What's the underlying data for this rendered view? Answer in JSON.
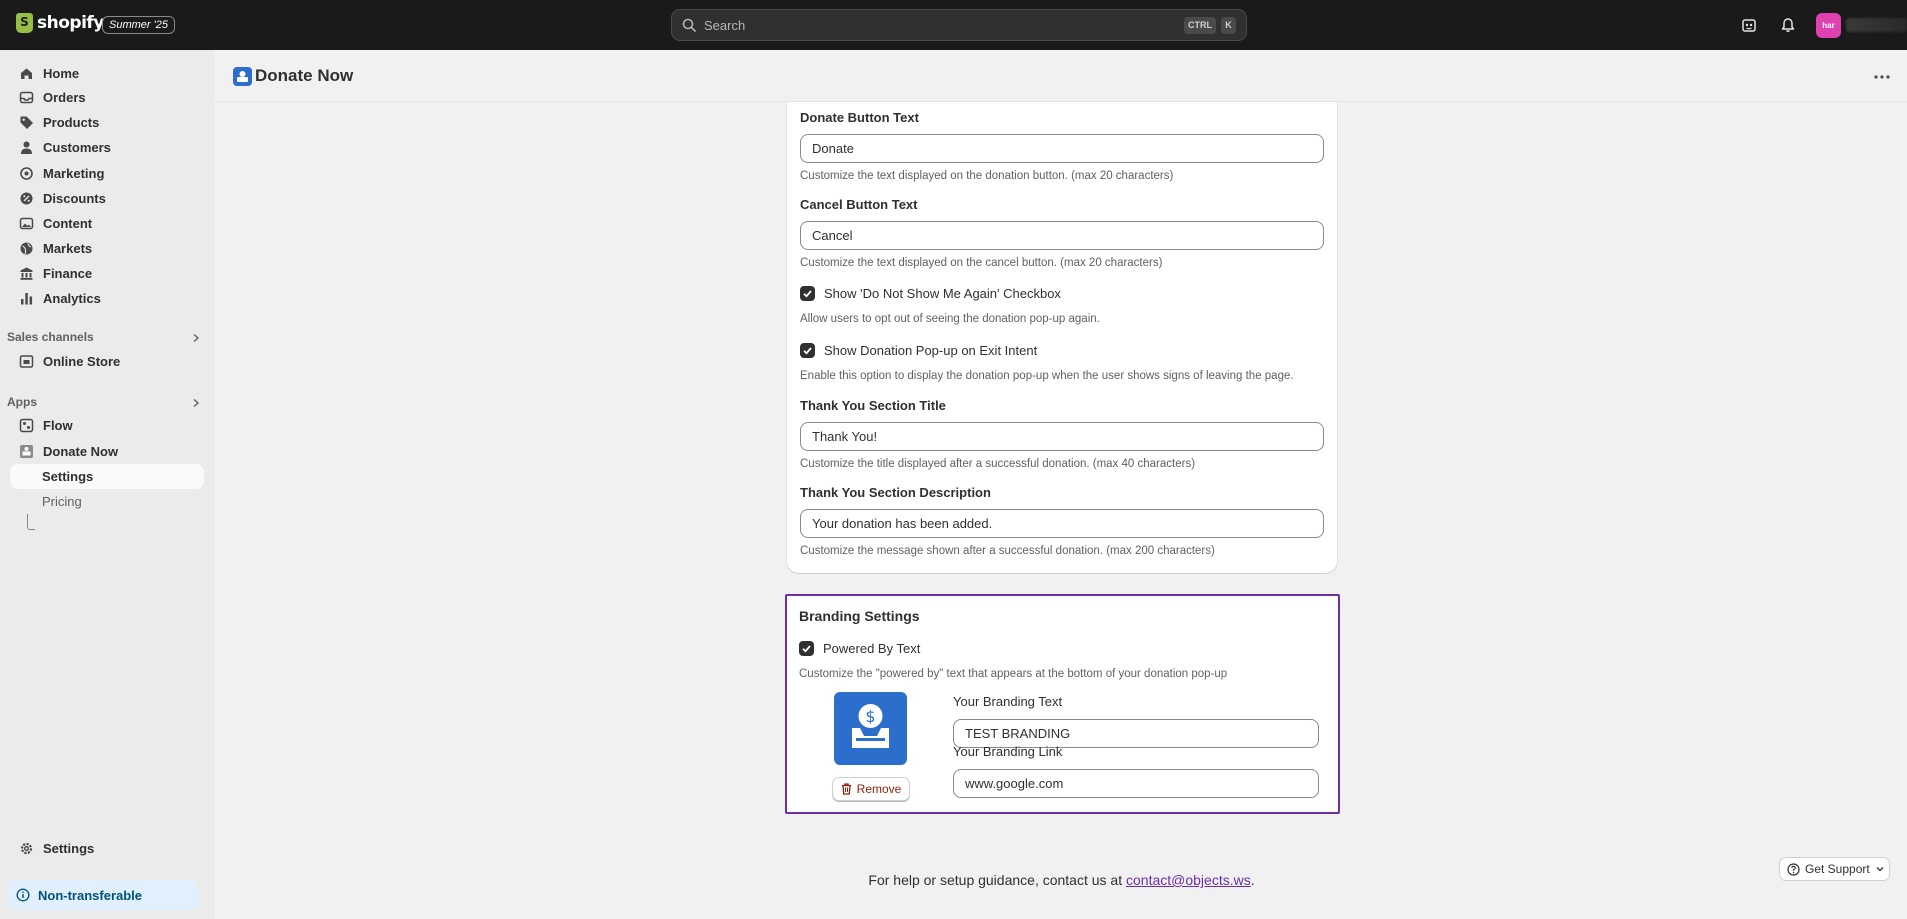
{
  "topbar": {
    "logo_text": "shopify",
    "edition_badge": "Summer '25",
    "search_placeholder": "Search",
    "shortcut_ctrl": "CTRL",
    "shortcut_k": "K",
    "avatar_initials": "har"
  },
  "sidebar": {
    "items": [
      {
        "label": "Home",
        "icon": "home-icon"
      },
      {
        "label": "Orders",
        "icon": "inbox-icon"
      },
      {
        "label": "Products",
        "icon": "tag-icon"
      },
      {
        "label": "Customers",
        "icon": "person-icon"
      },
      {
        "label": "Marketing",
        "icon": "target-icon"
      },
      {
        "label": "Discounts",
        "icon": "discount-icon"
      },
      {
        "label": "Content",
        "icon": "image-icon"
      },
      {
        "label": "Markets",
        "icon": "globe-icon"
      },
      {
        "label": "Finance",
        "icon": "bank-icon"
      },
      {
        "label": "Analytics",
        "icon": "bar-chart-icon"
      }
    ],
    "sales_channels_label": "Sales channels",
    "online_store_label": "Online Store",
    "apps_label": "Apps",
    "flow_label": "Flow",
    "donate_now_label": "Donate Now",
    "settings_sub_label": "Settings",
    "pricing_sub_label": "Pricing",
    "settings_label": "Settings",
    "non_transferable_label": "Non-transferable"
  },
  "page": {
    "title": "Donate Now"
  },
  "form": {
    "donate_button_text_label": "Donate Button Text",
    "donate_button_text_value": "Donate",
    "donate_button_text_help": "Customize the text displayed on the donation button. (max 20 characters)",
    "cancel_button_text_label": "Cancel Button Text",
    "cancel_button_text_value": "Cancel",
    "cancel_button_text_help": "Customize the text displayed on the cancel button. (max 20 characters)",
    "show_dont_show_again_label": "Show 'Do Not Show Me Again' Checkbox",
    "show_dont_show_again_checked": true,
    "show_dont_show_again_help": "Allow users to opt out of seeing the donation pop-up again.",
    "exit_intent_label": "Show Donation Pop-up on Exit Intent",
    "exit_intent_checked": true,
    "exit_intent_help": "Enable this option to display the donation pop-up when the user shows signs of leaving the page.",
    "thank_you_title_label": "Thank You Section Title",
    "thank_you_title_value": "Thank You!",
    "thank_you_title_help": "Customize the title displayed after a successful donation. (max 40 characters)",
    "thank_you_desc_label": "Thank You Section Description",
    "thank_you_desc_value": "Your donation has been added.",
    "thank_you_desc_help": "Customize the message shown after a successful donation. (max 200 characters)"
  },
  "branding": {
    "title": "Branding Settings",
    "powered_by_label": "Powered By Text",
    "powered_by_checked": true,
    "powered_by_help": "Customize the \"powered by\" text that appears at the bottom of your donation pop-up",
    "remove_label": "Remove",
    "branding_text_label": "Your Branding Text",
    "branding_text_value": "TEST BRANDING",
    "branding_link_label": "Your Branding Link",
    "branding_link_value": "www.google.com"
  },
  "footer": {
    "help_prefix": "For help or setup guidance, contact us at ",
    "email": "contact@objects.ws",
    "help_suffix": ".",
    "support_label": "Get Support"
  },
  "colors": {
    "accent_purple": "#6c2ea8",
    "app_blue": "#2c6ecb",
    "avatar_pink": "#e041b0"
  }
}
